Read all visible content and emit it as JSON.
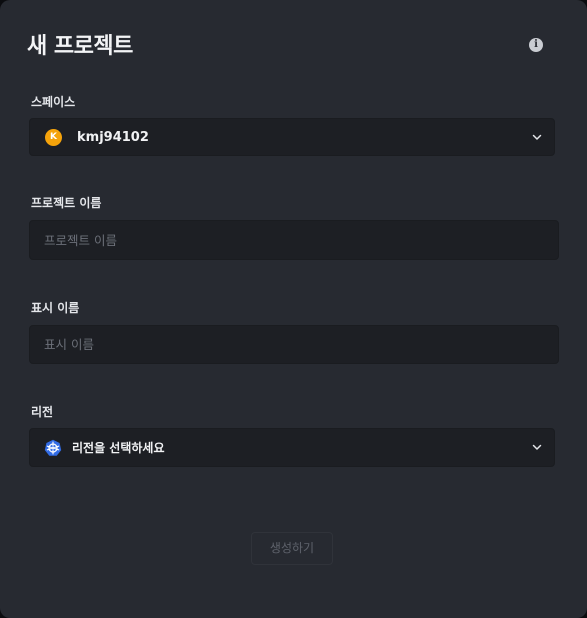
{
  "dialog": {
    "title": "새 프로젝트"
  },
  "space": {
    "label": "스페이스",
    "avatar_letter": "K",
    "selected": "kmj94102",
    "avatar_color": "#f5a30b"
  },
  "project_name": {
    "label": "프로젝트 이름",
    "value": "",
    "placeholder": "프로젝트 이름"
  },
  "display_name": {
    "label": "표시 이름",
    "value": "",
    "placeholder": "표시 이름"
  },
  "region": {
    "label": "리전",
    "selected": "리전을 선택하세요",
    "icon": "kubernetes-icon",
    "icon_color": "#326ce5"
  },
  "actions": {
    "create_label": "생성하기"
  }
}
